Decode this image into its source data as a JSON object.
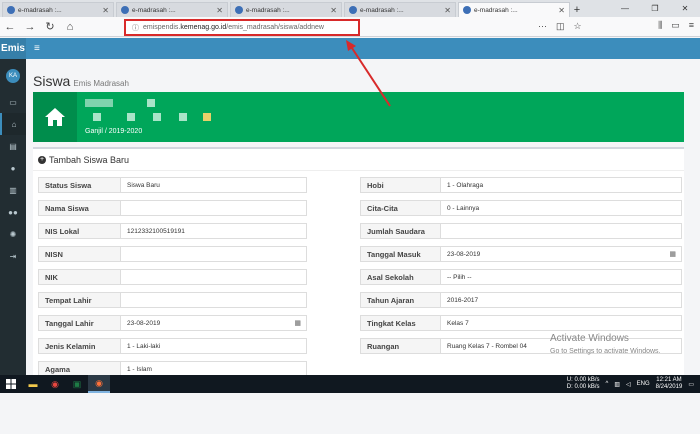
{
  "browser": {
    "tabs": [
      {
        "label": "e-madrasah :..."
      },
      {
        "label": "e-madrasah :..."
      },
      {
        "label": "e-madrasah :..."
      },
      {
        "label": "e-madrasah :..."
      },
      {
        "label": "e-madrasah :..."
      }
    ],
    "url_prefix": "emispendis.",
    "url_host": "kemenag.go.id",
    "url_path": "/emis_madrasah/siswa/addnew"
  },
  "app": {
    "brand": "Emis",
    "avatar_initials": "KA",
    "page_title": "Siswa",
    "page_subtitle": "Emis Madrasah",
    "periode": "Ganjil / 2019-2020",
    "form_title": "Tambah Siswa Baru"
  },
  "form": {
    "left": [
      {
        "label": "Status Siswa",
        "value": "Siswa Baru"
      },
      {
        "label": "Nama Siswa",
        "value": ""
      },
      {
        "label": "NIS Lokal",
        "value": "1212332100519191"
      },
      {
        "label": "NISN",
        "value": ""
      },
      {
        "label": "NIK",
        "value": ""
      },
      {
        "label": "Tempat Lahir",
        "value": ""
      },
      {
        "label": "Tanggal Lahir",
        "value": "23-08-2019"
      },
      {
        "label": "Jenis Kelamin",
        "value": "1 - Laki-laki"
      },
      {
        "label": "Agama",
        "value": "1 - Islam"
      }
    ],
    "right": [
      {
        "label": "Hobi",
        "value": "1 - Olahraga"
      },
      {
        "label": "Cita-Cita",
        "value": "0 - Lainnya"
      },
      {
        "label": "Jumlah Saudara",
        "value": ""
      },
      {
        "label": "Tanggal Masuk",
        "value": "23-08-2019"
      },
      {
        "label": "Asal Sekolah",
        "value": "-- Pilih --"
      },
      {
        "label": "Tahun Ajaran",
        "value": "2016-2017"
      },
      {
        "label": "Tingkat Kelas",
        "value": "Kelas 7"
      },
      {
        "label": "Ruangan",
        "value": "Ruang Kelas 7 - Rombel 04"
      }
    ]
  },
  "watermark": {
    "line1": "Activate Windows",
    "line2": "Go to Settings to activate Windows."
  },
  "taskbar": {
    "net_up": "0.00 kB/s",
    "net_down": "0.00 kB/s",
    "up_label": "U:",
    "down_label": "D:",
    "lang": "ENG",
    "time": "12:21 AM",
    "date": "8/24/2019"
  },
  "colors": {
    "primary": "#3c8dbc",
    "green": "#00a65a",
    "sidebar": "#222d32",
    "highlight": "#d82a2a"
  }
}
